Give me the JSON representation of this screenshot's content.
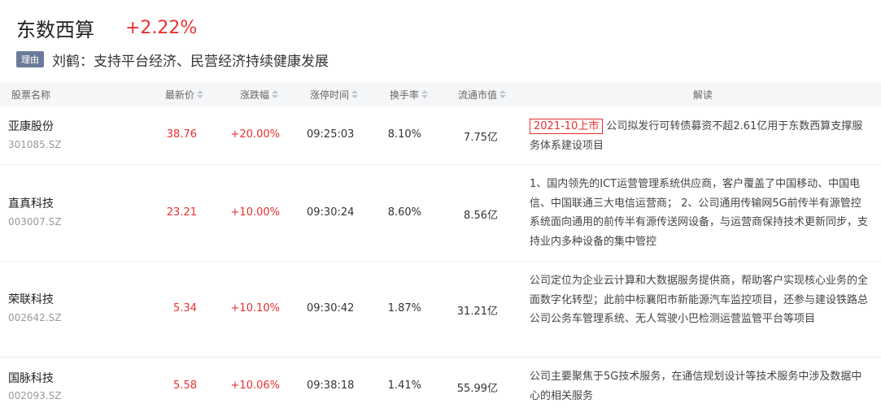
{
  "header": {
    "title": "东数西算",
    "change": "+2.22%"
  },
  "reason": {
    "badge": "理由",
    "text": "刘鹤：支持平台经济、民营经济持续健康发展"
  },
  "columns": {
    "name": "股票名称",
    "price": "最新价",
    "pct": "涨跌幅",
    "limit_time": "涨停时间",
    "turnover": "换手率",
    "mktcap": "流通市值",
    "desc": "解读"
  },
  "rows": [
    {
      "name": "亚康股份",
      "code": "301085.SZ",
      "price": "38.76",
      "pct": "+20.00%",
      "time": "09:25:03",
      "turnover": "8.10%",
      "mktcap": "7.75亿",
      "tag": "2021-10上市",
      "desc": "公司拟发行可转债募资不超2.61亿用于东数西算支撑服务体系建设项目"
    },
    {
      "name": "直真科技",
      "code": "003007.SZ",
      "price": "23.21",
      "pct": "+10.00%",
      "time": "09:30:24",
      "turnover": "8.60%",
      "mktcap": "8.56亿",
      "tag": "",
      "desc": "1、国内领先的ICT运营管理系统供应商，客户覆盖了中国移动、中国电信、中国联通三大电信运营商； 2、公司通用传输网5G前传半有源管控系统面向通用的前传半有源传送网设备，与运营商保持技术更新同步，支持业内多种设备的集中管控"
    },
    {
      "name": "荣联科技",
      "code": "002642.SZ",
      "price": "5.34",
      "pct": "+10.10%",
      "time": "09:30:42",
      "turnover": "1.87%",
      "mktcap": "31.21亿",
      "tag": "",
      "desc": "公司定位为企业云计算和大数据服务提供商，帮助客户实现核心业务的全面数字化转型；此前中标襄阳市新能源汽车监控项目，还参与建设铁路总公司公务车管理系统、无人驾驶小巴检测运营监管平台等项目"
    },
    {
      "name": "国脉科技",
      "code": "002093.SZ",
      "price": "5.58",
      "pct": "+10.06%",
      "time": "09:38:18",
      "turnover": "1.41%",
      "mktcap": "55.99亿",
      "tag": "",
      "desc": "公司主要聚焦于5G技术服务，在通信规划设计等技术服务中涉及数据中心的相关服务"
    }
  ],
  "colors": {
    "up": "#e93030",
    "badge": "#6b7a99",
    "header_bg": "#f5f6f8"
  }
}
